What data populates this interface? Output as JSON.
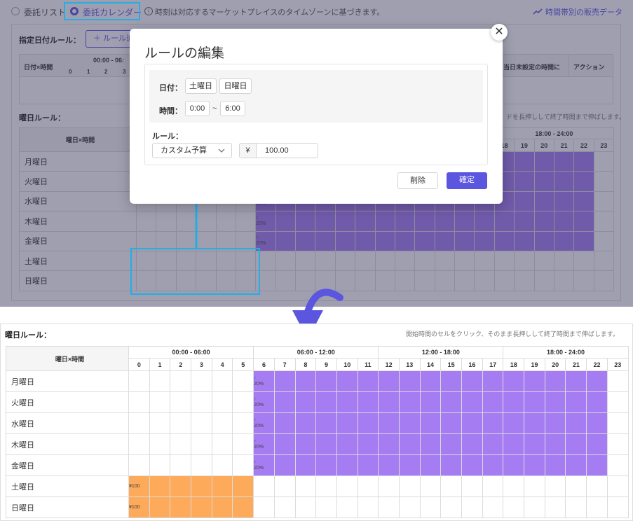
{
  "top": {
    "radio_list": "委託リスト",
    "radio_calendar": "委託カレンダー",
    "info_text": "時刻は対応するマーケットプレイスのタイムゾーンに基づきます。",
    "sales_link": "時間帯別の販売データ",
    "date_rule_label": "指定日付ルール：",
    "add_rule": "＋ ルール追",
    "date_table_header": "日付×時間",
    "date_range_header": "00:00 - 06:",
    "date_hours": [
      "0",
      "1",
      "2",
      "3"
    ],
    "unset_header": "当日未設定の時間に",
    "action_header": "アクション",
    "weekday_rule_label": "曜日ルール：",
    "weekday_hint": "ドを長押しして終了時間まで伸ばします。",
    "range_partial": "18:00 - 24:00",
    "hours_partial": [
      "18",
      "19",
      "20",
      "21",
      "22",
      "23"
    ]
  },
  "modal": {
    "title": "ルールの編集",
    "date_label": "日付：",
    "date_values": [
      "土曜日",
      "日曜日"
    ],
    "time_label": "時間：",
    "time_start": "0:00",
    "time_sep": "~",
    "time_end": "6:00",
    "rule_label": "ルール：",
    "rule_select": "カスタム予算",
    "currency": "¥",
    "amount": "100.00",
    "delete_button": "削除",
    "confirm_button": "確定",
    "close": "✕"
  },
  "weekday_grid": {
    "title": "曜日ルール：",
    "hint": "開始時間のセルをクリック、そのまま長押しして終了時間まで伸ばします。",
    "corner": "曜日×時間",
    "ranges": [
      "00:00 - 06:00",
      "06:00 - 12:00",
      "12:00 - 18:00",
      "18:00 - 24:00"
    ],
    "hours": [
      "0",
      "1",
      "2",
      "3",
      "4",
      "5",
      "6",
      "7",
      "8",
      "9",
      "10",
      "11",
      "12",
      "13",
      "14",
      "15",
      "16",
      "17",
      "18",
      "19",
      "20",
      "21",
      "22",
      "23"
    ],
    "rows": [
      {
        "day": "月曜日",
        "type": "pct",
        "start": 6,
        "end": 22,
        "label": "20%",
        "arrow": "↑"
      },
      {
        "day": "火曜日",
        "type": "pct",
        "start": 6,
        "end": 22,
        "label": "20%",
        "arrow": "↑"
      },
      {
        "day": "水曜日",
        "type": "pct",
        "start": 6,
        "end": 22,
        "label": "20%",
        "arrow": "↑"
      },
      {
        "day": "木曜日",
        "type": "pct",
        "start": 6,
        "end": 22,
        "label": "20%",
        "arrow": "↑"
      },
      {
        "day": "金曜日",
        "type": "pct",
        "start": 6,
        "end": 22,
        "label": "20%",
        "arrow": "↑"
      },
      {
        "day": "土曜日",
        "type": "amt",
        "start": 0,
        "end": 5,
        "label": "¥100"
      },
      {
        "day": "日曜日",
        "type": "amt",
        "start": 0,
        "end": 5,
        "label": "¥100"
      }
    ]
  },
  "colors": {
    "accent": "#5b55e0",
    "purple_fill": "#a67cf3",
    "orange_fill": "#fdaa5a",
    "highlight": "#22aee6"
  }
}
